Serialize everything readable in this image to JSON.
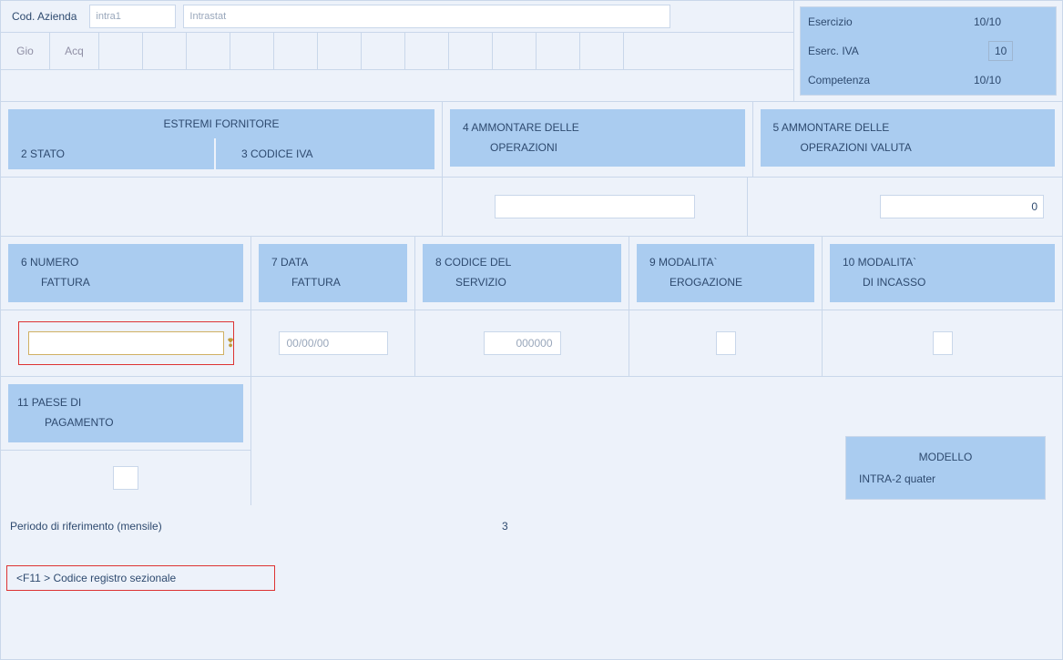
{
  "header": {
    "cod_azienda_label": "Cod. Azienda",
    "cod_azienda_value": "intra1",
    "azienda_desc_value": "Intrastat",
    "esercizio_label": "Esercizio",
    "esercizio_value": "10/10",
    "eserc_iva_label": "Eserc. IVA",
    "eserc_iva_value": "10",
    "competenza_label": "Competenza",
    "competenza_value": "10/10"
  },
  "tabs": [
    "Gio",
    "Acq"
  ],
  "big_headers": {
    "fornitore_title": "ESTREMI FORNITORE",
    "stato_label": "2 STATO",
    "codice_iva_label": "3 CODICE IVA",
    "col4_line1": "4 AMMONTARE DELLE",
    "col4_line2": "OPERAZIONI",
    "col5_line1": "5 AMMONTARE DELLE",
    "col5_line2": "OPERAZIONI VALUTA",
    "col5_value": "0"
  },
  "low_headers": {
    "c6a": "6 NUMERO",
    "c6b": "FATTURA",
    "c7a": "7 DATA",
    "c7b": "FATTURA",
    "c8a": "8 CODICE DEL",
    "c8b": "SERVIZIO",
    "c9a": "9 MODALITA`",
    "c9b": "EROGAZIONE",
    "c10a": "10 MODALITA`",
    "c10b": "DI INCASSO"
  },
  "low_values": {
    "data_fattura": "00/00/00",
    "codice_servizio": "000000"
  },
  "row11": {
    "line1": "11 PAESE DI",
    "line2": "PAGAMENTO"
  },
  "modello": {
    "title": "MODELLO",
    "value": "INTRA-2 quater"
  },
  "periodo": {
    "label": "Periodo di riferimento (mensile)",
    "value": "3"
  },
  "hint": {
    "text": "<F11            > Codice registro sezionale"
  }
}
